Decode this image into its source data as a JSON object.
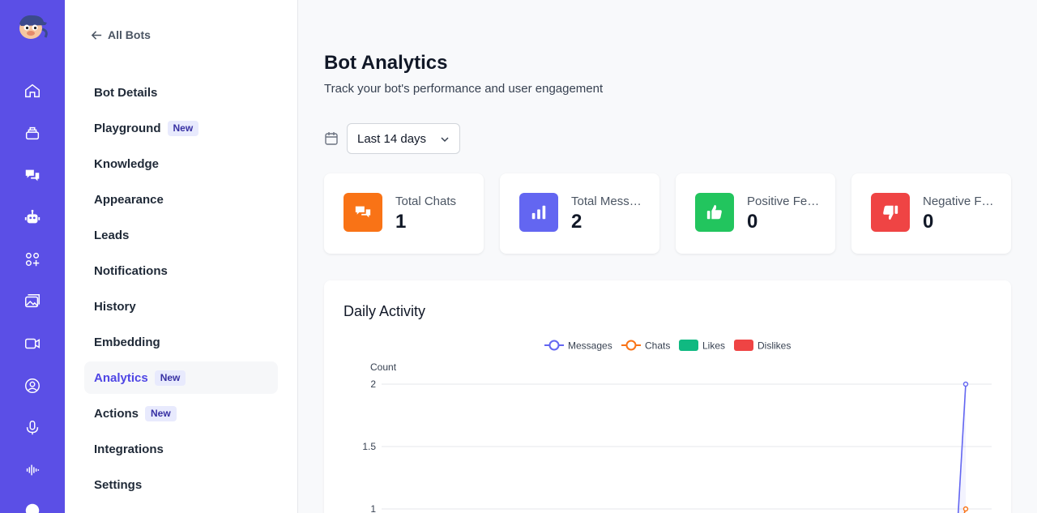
{
  "back_label": "All Bots",
  "nav": [
    {
      "label": "Bot Details",
      "badge": ""
    },
    {
      "label": "Playground",
      "badge": "New"
    },
    {
      "label": "Knowledge",
      "badge": ""
    },
    {
      "label": "Appearance",
      "badge": ""
    },
    {
      "label": "Leads",
      "badge": ""
    },
    {
      "label": "Notifications",
      "badge": ""
    },
    {
      "label": "History",
      "badge": ""
    },
    {
      "label": "Embedding",
      "badge": ""
    },
    {
      "label": "Analytics",
      "badge": "New",
      "active": true
    },
    {
      "label": "Actions",
      "badge": "New"
    },
    {
      "label": "Integrations",
      "badge": ""
    },
    {
      "label": "Settings",
      "badge": ""
    }
  ],
  "header": {
    "title": "Bot Analytics",
    "subtitle": "Track your bot's performance and user engagement"
  },
  "range_select": {
    "value": "Last 14 days"
  },
  "stats": [
    {
      "label": "Total Chats",
      "value": "1",
      "color": "#f97316",
      "icon": "chat-icon"
    },
    {
      "label": "Total Messages",
      "value": "2",
      "color": "#6366f1",
      "icon": "bar-chart-icon"
    },
    {
      "label": "Positive Feedback",
      "value": "0",
      "color": "#22c55e",
      "icon": "thumbs-up-icon"
    },
    {
      "label": "Negative Feedback",
      "value": "0",
      "color": "#ef4444",
      "icon": "thumbs-down-icon"
    }
  ],
  "activity": {
    "title": "Daily Activity"
  },
  "chart_data": {
    "type": "line",
    "ylabel": "Count",
    "y_ticks": [
      "2",
      "1.5",
      "1"
    ],
    "ylim": [
      1,
      2
    ],
    "legend": [
      {
        "name": "Messages",
        "color": "#6366f1",
        "kind": "line"
      },
      {
        "name": "Chats",
        "color": "#f97316",
        "kind": "line"
      },
      {
        "name": "Likes",
        "color": "#10b981",
        "kind": "box"
      },
      {
        "name": "Dislikes",
        "color": "#ef4444",
        "kind": "box"
      }
    ],
    "series": [
      {
        "name": "Messages",
        "last_value": 2
      },
      {
        "name": "Chats",
        "last_value": 1
      }
    ],
    "legend_placement": "top-center",
    "grid": true
  }
}
